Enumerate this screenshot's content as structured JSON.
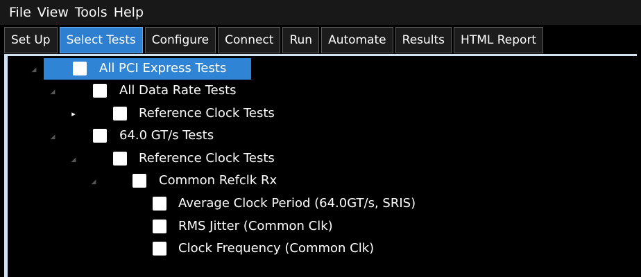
{
  "menu": {
    "items": [
      "File",
      "View",
      "Tools",
      "Help"
    ]
  },
  "tabs": [
    {
      "label": "Set Up",
      "active": false
    },
    {
      "label": "Select Tests",
      "active": true
    },
    {
      "label": "Configure",
      "active": false
    },
    {
      "label": "Connect",
      "active": false
    },
    {
      "label": "Run",
      "active": false
    },
    {
      "label": "Automate",
      "active": false
    },
    {
      "label": "Results",
      "active": false
    },
    {
      "label": "HTML Report",
      "active": false
    }
  ],
  "tree": {
    "nodes": [
      {
        "label": "All PCI Express Tests",
        "expander": "expanded",
        "selected": true,
        "checked": false
      },
      {
        "label": "All Data Rate Tests",
        "expander": "expanded",
        "selected": false,
        "checked": false
      },
      {
        "label": "Reference Clock Tests",
        "expander": "collapsed",
        "selected": false,
        "checked": false
      },
      {
        "label": "64.0 GT/s Tests",
        "expander": "expanded",
        "selected": false,
        "checked": false
      },
      {
        "label": "Reference Clock Tests",
        "expander": "expanded",
        "selected": false,
        "checked": false
      },
      {
        "label": "Common Refclk Rx",
        "expander": "expanded",
        "selected": false,
        "checked": false
      },
      {
        "label": "Average Clock Period (64.0GT/s, SRIS)",
        "expander": "none",
        "selected": false,
        "checked": false
      },
      {
        "label": "RMS Jitter (Common Clk)",
        "expander": "none",
        "selected": false,
        "checked": false
      },
      {
        "label": "Clock Frequency (Common Clk)",
        "expander": "none",
        "selected": false,
        "checked": false
      }
    ]
  },
  "colors": {
    "accent": "#2f84d6",
    "menubar_bg": "#181818",
    "tree_strip": "#cfe3f3"
  }
}
